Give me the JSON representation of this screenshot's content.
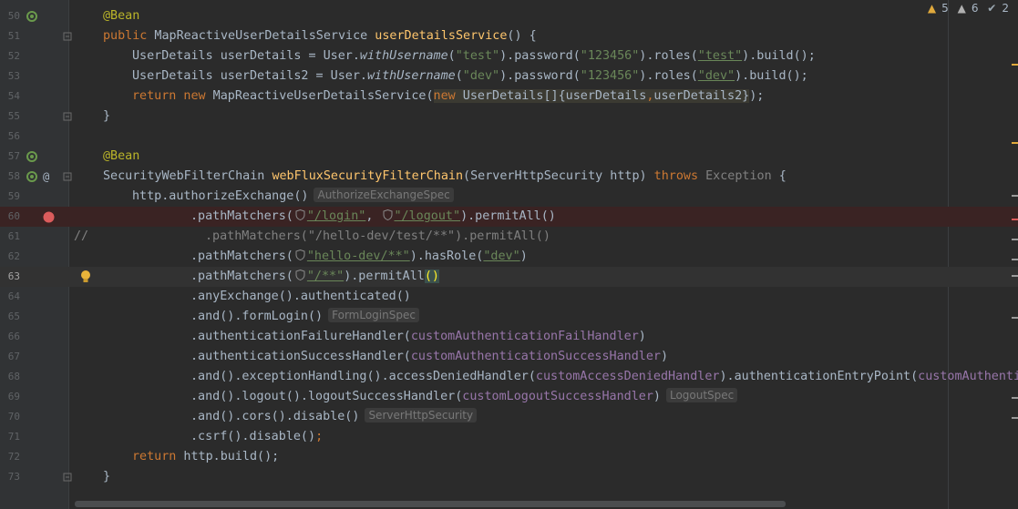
{
  "inspections": {
    "warnings": "5",
    "weak_warnings": "6",
    "ok": "2"
  },
  "gutter": {
    "line_numbers": [
      "50",
      "51",
      "52",
      "53",
      "54",
      "55",
      "56",
      "57",
      "58",
      "59",
      "60",
      "61",
      "62",
      "63",
      "64",
      "65",
      "66",
      "67",
      "68",
      "69",
      "70",
      "71",
      "72",
      "73"
    ],
    "current_line": "63"
  },
  "lines": {
    "l50": {
      "anno": "@Bean"
    },
    "l51": {
      "kw": "public",
      "type": " MapReactiveUserDetailsService ",
      "fn": "userDetailsService",
      "rest": "() {"
    },
    "l52": {
      "a": "UserDetails userDetails = User.",
      "m": "withUsername",
      "b": "(",
      "s1": "\"test\"",
      "c": ").password(",
      "s2": "\"123456\"",
      "d": ").roles(",
      "s3": "\"test\"",
      "e": ").build();"
    },
    "l53": {
      "a": "UserDetails userDetails2 = User.",
      "m": "withUsername",
      "b": "(",
      "s1": "\"dev\"",
      "c": ").password(",
      "s2": "\"123456\"",
      "d": ").roles(",
      "s3": "\"dev\"",
      "e": ").build();"
    },
    "l54": {
      "kw": "return new",
      "a": " MapReactiveUserDetailsService(",
      "kw2": "new",
      "b": " UserDetails[]{userDetails",
      "comma": ",",
      "c": "userDetails2}",
      "d": ");"
    },
    "l55": {
      "text": "}"
    },
    "l57": {
      "anno": "@Bean"
    },
    "l58": {
      "type": "SecurityWebFilterChain ",
      "fn": "webFluxSecurityFilterChain",
      "a": "(ServerHttpSecurity http) ",
      "kw": "throws",
      "b": " Exception",
      "c": " {"
    },
    "l59": {
      "a": "http.authorizeExchange()",
      "hint": "AuthorizeExchangeSpec"
    },
    "l60": {
      "a": ".pathMatchers(",
      "s1": "\"/login\"",
      "c": ", ",
      "s2": "\"/logout\"",
      "d": ").permitAll()"
    },
    "l61": {
      "slashes": "//",
      "text": ".pathMatchers(\"/hello-dev/test/**\").permitAll()"
    },
    "l62": {
      "a": ".pathMatchers(",
      "s1": "\"hello-dev/**\"",
      "b": ").hasRole(",
      "s2": "\"dev\"",
      "c": ")"
    },
    "l63": {
      "a": ".pathMatchers(",
      "s1": "\"/**\"",
      "b": ").permitAll",
      "paren": "()"
    },
    "l64": {
      "text": ".anyExchange().authenticated()"
    },
    "l65": {
      "a": ".and().formLogin()",
      "hint": "FormLoginSpec"
    },
    "l66": {
      "a": ".authenticationFailureHandler(",
      "f": "customAuthenticationFailHandler",
      "b": ")"
    },
    "l67": {
      "a": ".authenticationSuccessHandler(",
      "f": "customAuthenticationSuccessHandler",
      "b": ")"
    },
    "l68": {
      "a": ".and().exceptionHandling().accessDeniedHandler(",
      "f": "customAccessDeniedHandler",
      "b": ").authenticationEntryPoint(",
      "f2": "customAuthentic"
    },
    "l69": {
      "a": ".and().logout().logoutSuccessHandler(",
      "f": "customLogoutSuccessHandler",
      "b": ")",
      "hint": "LogoutSpec"
    },
    "l70": {
      "a": ".and().cors().disable()",
      "hint": "ServerHttpSecurity"
    },
    "l71": {
      "a": ".csrf().disable()",
      "b": ";"
    },
    "l72": {
      "kw": "return",
      "a": " http.build();"
    },
    "l73": {
      "text": "}"
    }
  },
  "colors": {
    "background": "#2b2b2b",
    "keyword": "#cc7832",
    "string": "#6a8759",
    "annotation": "#bbb529",
    "field": "#9876aa",
    "method": "#ffc66d",
    "breakpoint": "#db5c5c"
  }
}
